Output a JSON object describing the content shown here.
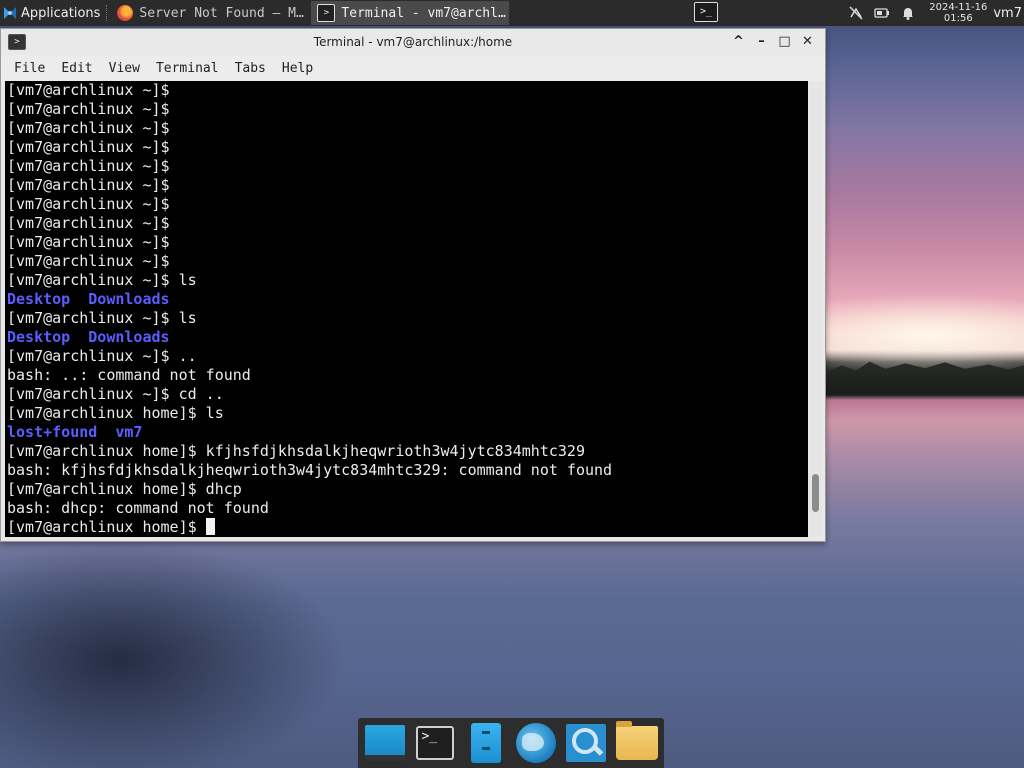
{
  "panel": {
    "apps_label": "Applications",
    "tasks": [
      {
        "label": "Server Not Found — M…",
        "icon": "firefox-icon",
        "active": false
      },
      {
        "label": "Terminal - vm7@archl…",
        "icon": "terminal-icon",
        "active": true
      }
    ],
    "launcher_glyph": ">_",
    "clock_date": "2024-11-16",
    "clock_time": "01:56",
    "user": "vm7"
  },
  "window": {
    "title": "Terminal - vm7@archlinux:/home",
    "controls": {
      "shade": "^",
      "minimize": "–",
      "maximize": "□",
      "close": "✕"
    },
    "menu": [
      "File",
      "Edit",
      "View",
      "Terminal",
      "Tabs",
      "Help"
    ]
  },
  "terminal": {
    "lines": [
      {
        "segments": [
          {
            "text": "[vm7@archlinux ~]$ ",
            "style": "normal"
          }
        ]
      },
      {
        "segments": [
          {
            "text": "[vm7@archlinux ~]$ ",
            "style": "normal"
          }
        ]
      },
      {
        "segments": [
          {
            "text": "[vm7@archlinux ~]$ ",
            "style": "normal"
          }
        ]
      },
      {
        "segments": [
          {
            "text": "[vm7@archlinux ~]$ ",
            "style": "normal"
          }
        ]
      },
      {
        "segments": [
          {
            "text": "[vm7@archlinux ~]$ ",
            "style": "normal"
          }
        ]
      },
      {
        "segments": [
          {
            "text": "[vm7@archlinux ~]$ ",
            "style": "normal"
          }
        ]
      },
      {
        "segments": [
          {
            "text": "[vm7@archlinux ~]$ ",
            "style": "normal"
          }
        ]
      },
      {
        "segments": [
          {
            "text": "[vm7@archlinux ~]$ ",
            "style": "normal"
          }
        ]
      },
      {
        "segments": [
          {
            "text": "[vm7@archlinux ~]$ ",
            "style": "normal"
          }
        ]
      },
      {
        "segments": [
          {
            "text": "[vm7@archlinux ~]$ ",
            "style": "normal"
          }
        ]
      },
      {
        "segments": [
          {
            "text": "[vm7@archlinux ~]$ ls",
            "style": "normal"
          }
        ]
      },
      {
        "segments": [
          {
            "text": "Desktop",
            "style": "blue"
          },
          {
            "text": "  ",
            "style": "normal"
          },
          {
            "text": "Downloads",
            "style": "blue"
          }
        ]
      },
      {
        "segments": [
          {
            "text": "[vm7@archlinux ~]$ ls",
            "style": "normal"
          }
        ]
      },
      {
        "segments": [
          {
            "text": "Desktop",
            "style": "blue"
          },
          {
            "text": "  ",
            "style": "normal"
          },
          {
            "text": "Downloads",
            "style": "blue"
          }
        ]
      },
      {
        "segments": [
          {
            "text": "[vm7@archlinux ~]$ ..",
            "style": "normal"
          }
        ]
      },
      {
        "segments": [
          {
            "text": "bash: ..: command not found",
            "style": "normal"
          }
        ]
      },
      {
        "segments": [
          {
            "text": "[vm7@archlinux ~]$ cd ..",
            "style": "normal"
          }
        ]
      },
      {
        "segments": [
          {
            "text": "[vm7@archlinux home]$ ls",
            "style": "normal"
          }
        ]
      },
      {
        "segments": [
          {
            "text": "lost+found",
            "style": "blue"
          },
          {
            "text": "  ",
            "style": "normal"
          },
          {
            "text": "vm7",
            "style": "blue"
          }
        ]
      },
      {
        "segments": [
          {
            "text": "[vm7@archlinux home]$ kfjhsfdjkhsdalkjheqwrioth3w4jytc834mhtc329",
            "style": "normal"
          }
        ]
      },
      {
        "segments": [
          {
            "text": "bash: kfjhsfdjkhsdalkjheqwrioth3w4jytc834mhtc329: command not found",
            "style": "normal"
          }
        ]
      },
      {
        "segments": [
          {
            "text": "[vm7@archlinux home]$ dhcp",
            "style": "normal"
          }
        ]
      },
      {
        "segments": [
          {
            "text": "bash: dhcp: command not found",
            "style": "normal"
          }
        ]
      },
      {
        "segments": [
          {
            "text": "[vm7@archlinux home]$ ",
            "style": "normal"
          }
        ],
        "cursor": true
      }
    ],
    "scroll_position_fraction": 0.95
  },
  "dock": {
    "items": [
      {
        "name": "show-desktop-icon"
      },
      {
        "name": "terminal-icon",
        "glyph": ">_"
      },
      {
        "name": "file-manager-icon"
      },
      {
        "name": "web-browser-icon"
      },
      {
        "name": "app-finder-icon"
      },
      {
        "name": "folder-icon"
      }
    ]
  },
  "colors": {
    "terminal_bg": "#000000",
    "terminal_fg": "#ececec",
    "directory_blue": "#5c5cff",
    "panel_bg": "#2b2b2b"
  }
}
